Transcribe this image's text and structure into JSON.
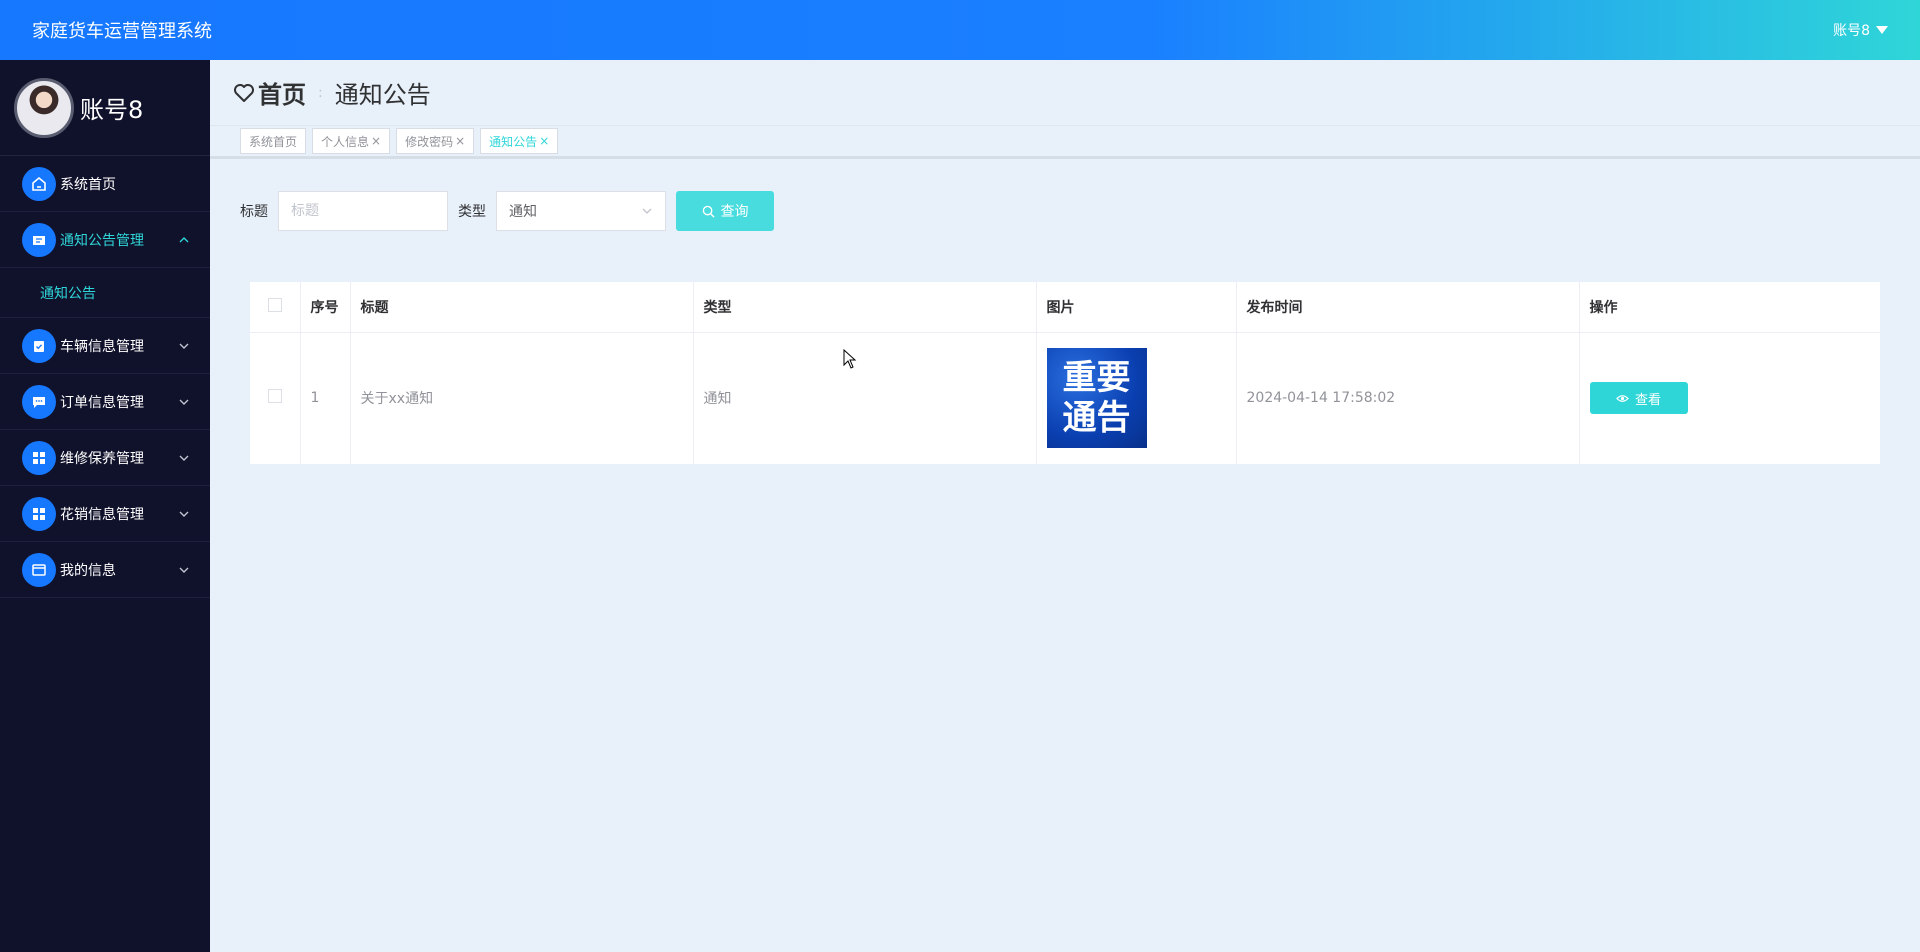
{
  "header": {
    "title": "家庭货车运营管理系统",
    "user": "账号8"
  },
  "sidebar": {
    "profile_name": "账号8",
    "items": [
      {
        "label": "系统首页",
        "icon": "home-icon"
      },
      {
        "label": "通知公告管理",
        "icon": "notice-icon",
        "expanded": true,
        "children": [
          {
            "label": "通知公告"
          }
        ]
      },
      {
        "label": "车辆信息管理",
        "icon": "clipboard-icon"
      },
      {
        "label": "订单信息管理",
        "icon": "chat-icon"
      },
      {
        "label": "维修保养管理",
        "icon": "grid-icon"
      },
      {
        "label": "花销信息管理",
        "icon": "grid-icon"
      },
      {
        "label": "我的信息",
        "icon": "wallet-icon"
      }
    ]
  },
  "breadcrumb": {
    "home": "首页",
    "separator": ":",
    "current": "通知公告"
  },
  "tags": [
    {
      "label": "系统首页",
      "closable": false
    },
    {
      "label": "个人信息",
      "closable": true
    },
    {
      "label": "修改密码",
      "closable": true
    },
    {
      "label": "通知公告",
      "closable": true,
      "active": true
    }
  ],
  "search": {
    "title_label": "标题",
    "title_placeholder": "标题",
    "type_label": "类型",
    "type_value": "通知",
    "button": "查询"
  },
  "table": {
    "columns": [
      "序号",
      "标题",
      "类型",
      "图片",
      "发布时间",
      "操作"
    ],
    "rows": [
      {
        "index": "1",
        "title": "关于xx通知",
        "type": "通知",
        "image_text": "重要\n通告",
        "published": "2024-04-14 17:58:02",
        "action": "查看"
      }
    ]
  },
  "colors": {
    "primary": "#1677ff",
    "accent": "#2fd6d8",
    "sidebar": "#10112b",
    "background": "#e8f0fa"
  }
}
